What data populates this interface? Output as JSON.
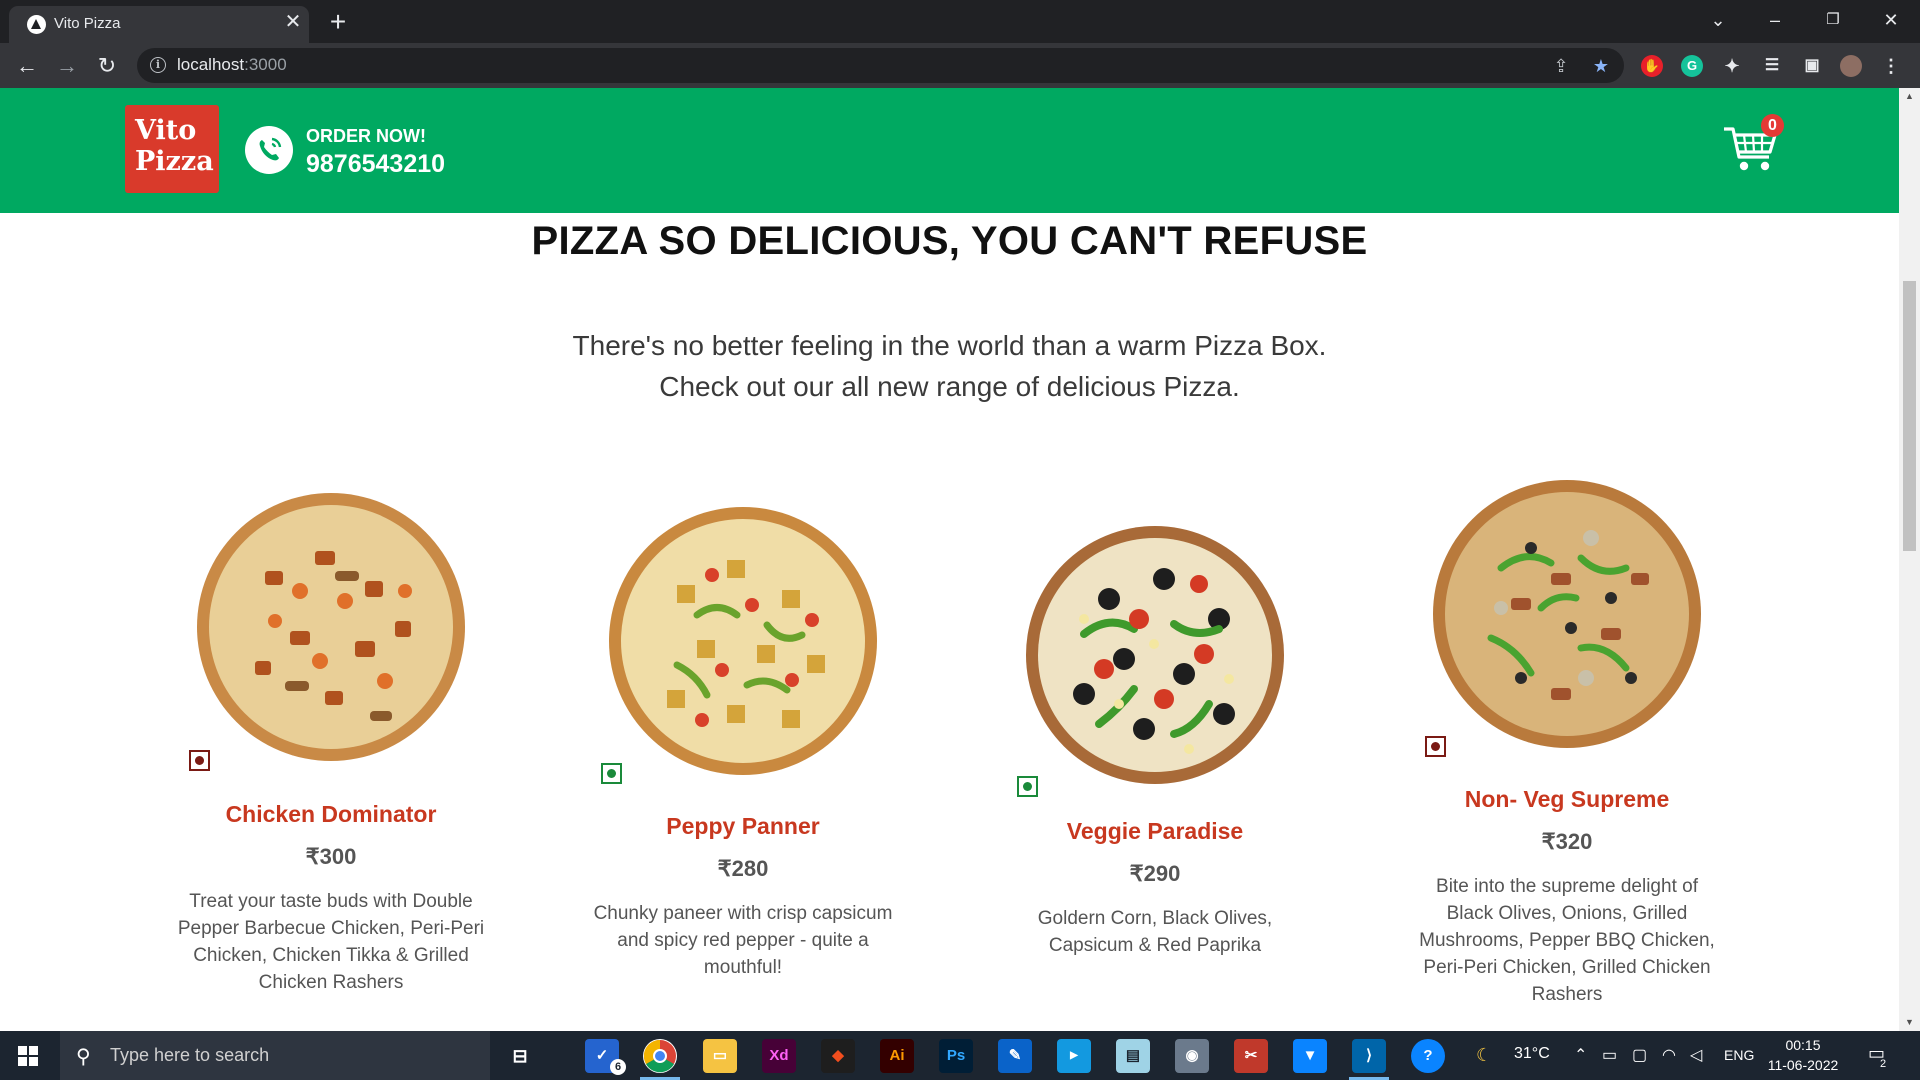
{
  "browser": {
    "tab_title": "Vito Pizza",
    "url_host": "localhost",
    "url_port": ":3000"
  },
  "header": {
    "logo_line1": "Vito",
    "logo_line2": "Pizza",
    "order_label": "ORDER NOW!",
    "phone": "9876543210",
    "cart_count": "0",
    "brand_green": "#00a961",
    "logo_red": "#d93a2b"
  },
  "hero": {
    "headline": "PIZZA SO DELICIOUS, YOU CAN'T REFUSE",
    "line1": "There's no better feeling in the world than a warm Pizza Box.",
    "line2": "Check out our all new range of delicious Pizza."
  },
  "pizzas": [
    {
      "name": "Chicken Dominator",
      "price": "₹300",
      "diet": "non-veg",
      "desc": "Treat your taste buds with Double Pepper Barbecue Chicken, Peri-Peri Chicken, Chicken Tikka & Grilled Chicken Rashers"
    },
    {
      "name": "Peppy Panner",
      "price": "₹280",
      "diet": "veg",
      "desc": "Chunky paneer with crisp capsicum and spicy red pepper - quite a mouthful!"
    },
    {
      "name": "Veggie Paradise",
      "price": "₹290",
      "diet": "veg",
      "desc": "Goldern Corn, Black Olives, Capsicum & Red Paprika"
    },
    {
      "name": "Non- Veg Supreme",
      "price": "₹320",
      "diet": "non-veg",
      "desc": "Bite into the supreme delight of Black Olives, Onions, Grilled Mushrooms, Pepper BBQ Chicken, Peri-Peri Chicken, Grilled Chicken Rashers"
    }
  ],
  "taskbar": {
    "search_placeholder": "Type here to search",
    "todo_badge": "6",
    "weather": "31°C",
    "language": "ENG",
    "time": "00:15",
    "date": "11-06-2022",
    "notification_count": "2"
  }
}
